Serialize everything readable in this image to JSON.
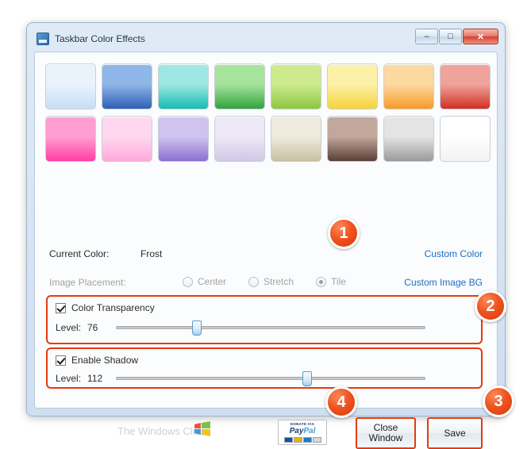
{
  "window": {
    "title": "Taskbar Color Effects",
    "icon": "taskbar-app-icon",
    "buttons": {
      "minimize": "–",
      "maximize": "□",
      "close": "✕"
    }
  },
  "swatches": [
    {
      "name": "Frost",
      "top": "#eaf3fc",
      "bottom": "#c7def5"
    },
    {
      "name": "Blue",
      "top": "#8fb6e8",
      "bottom": "#2f5fb4"
    },
    {
      "name": "Teal",
      "top": "#9fe7e2",
      "bottom": "#16bdb4"
    },
    {
      "name": "Green",
      "top": "#a6e39b",
      "bottom": "#31a341"
    },
    {
      "name": "Lime",
      "top": "#cdeb8e",
      "bottom": "#8cc63f"
    },
    {
      "name": "Yellow",
      "top": "#fdf1a9",
      "bottom": "#f6d33c"
    },
    {
      "name": "Orange",
      "top": "#fdd9a0",
      "bottom": "#f59a29"
    },
    {
      "name": "Red",
      "top": "#f0a39a",
      "bottom": "#d22f24"
    },
    {
      "name": "Pink",
      "top": "#ff9ed1",
      "bottom": "#ff3ea5"
    },
    {
      "name": "Light Pink",
      "top": "#ffd8ef",
      "bottom": "#ffa8dc"
    },
    {
      "name": "Purple",
      "top": "#cfc3ef",
      "bottom": "#8c6fd0"
    },
    {
      "name": "Lavender",
      "top": "#ede9f7",
      "bottom": "#cfc7e8"
    },
    {
      "name": "Sand",
      "top": "#eeeadd",
      "bottom": "#c9c0a3"
    },
    {
      "name": "Brown",
      "top": "#c2a79c",
      "bottom": "#5a4037"
    },
    {
      "name": "Gray",
      "top": "#e4e4e4",
      "bottom": "#9a9a9a"
    },
    {
      "name": "White",
      "top": "#ffffff",
      "bottom": "#f2f2f2"
    }
  ],
  "current_color": {
    "label": "Current Color:",
    "value": "Frost",
    "custom_link": "Custom Color"
  },
  "image_placement": {
    "label": "Image Placement:",
    "options": [
      "Center",
      "Stretch",
      "Tile"
    ],
    "selected": "Tile",
    "custom_link": "Custom Image BG"
  },
  "color_transparency": {
    "checkbox_label": "Color Transparency",
    "checked": true,
    "level_label": "Level:",
    "level_value": "76",
    "slider_percent": 25
  },
  "enable_shadow": {
    "checkbox_label": "Enable Shadow",
    "checked": true,
    "level_label": "Level:",
    "level_value": "112",
    "slider_percent": 62
  },
  "footer": {
    "brand": "The Windows Club",
    "paypal": {
      "top_line": "DONATE VIA",
      "word_1": "Pay",
      "word_2": "Pal"
    },
    "close_button": "Close Window",
    "save_button": "Save"
  },
  "annotations": {
    "badge_1": "1",
    "badge_2": "2",
    "badge_3": "3",
    "badge_4": "4",
    "highlight_color": "#e23c12"
  }
}
